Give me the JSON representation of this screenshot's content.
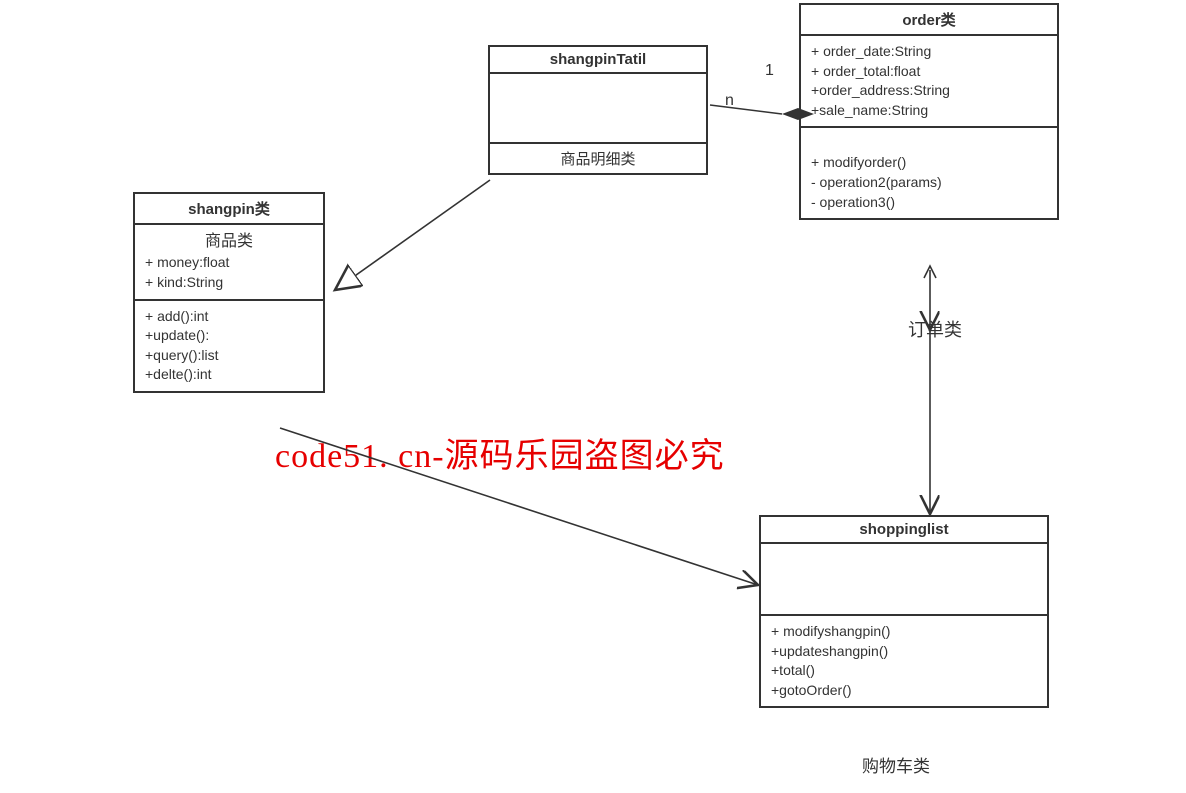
{
  "classes": {
    "shangpin": {
      "title": "shangpin类",
      "overlay_label": "商品类",
      "attrs": [
        "+ money:float",
        "+ kind:String"
      ],
      "ops": [
        "+ add():int",
        "+update():",
        "+query():list",
        "+delte():int"
      ]
    },
    "shangpinTatil": {
      "title": "shangpinTatil",
      "note": "商品明细类"
    },
    "order": {
      "title": "order类",
      "attrs": [
        "+ order_date:String",
        "+ order_total:float",
        "+order_address:String",
        "+sale_name:String"
      ],
      "ops": [
        "+ modifyorder()",
        "- operation2(params)",
        "- operation3()"
      ]
    },
    "shoppinglist": {
      "title": "shoppinglist",
      "ops": [
        "+ modifyshangpin()",
        "+updateshangpin()",
        "+total()",
        "+gotoOrder()"
      ],
      "bottom_label": "购物车类"
    }
  },
  "labels": {
    "one": "1",
    "n": "n",
    "order_assoc": "订单类"
  },
  "watermark": "code51. cn-源码乐园盗图必究"
}
